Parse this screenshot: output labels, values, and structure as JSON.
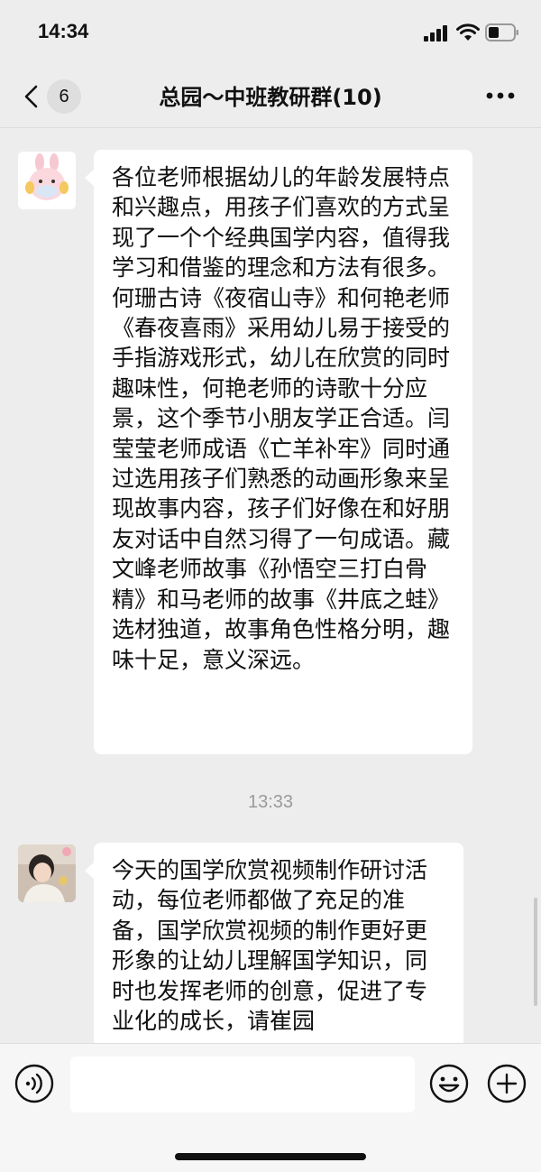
{
  "status_bar": {
    "time": "14:34",
    "icons": [
      "signal-icon",
      "wifi-icon",
      "battery-icon"
    ]
  },
  "nav": {
    "back_icon": "chevron-left-icon",
    "unread_count": "6",
    "title": "总园～中班教研群(10)",
    "more_icon": "more-dots-icon"
  },
  "messages": [
    {
      "avatar_icon": "bunny-avatar",
      "text": "各位老师根据幼儿的年龄发展特点和兴趣点，用孩子们喜欢的方式呈现了一个个经典国学内容，值得我学习和借鉴的理念和方法有很多。何珊古诗《夜宿山寺》和何艳老师《春夜喜雨》采用幼儿易于接受的手指游戏形式，幼儿在欣赏的同时趣味性，何艳老师的诗歌十分应景，这个季节小朋友学正合适。闫莹莹老师成语《亡羊补牢》同时通过选用孩子们熟悉的动画形象来呈现故事内容，孩子们好像在和好朋友对话中自然习得了一句成语。藏文峰老师故事《孙悟空三打白骨精》和马老师的故事《井底之蛙》选材独道，故事角色性格分明，趣味十足，意义深远。"
    },
    {
      "avatar_icon": "photo-avatar",
      "text": "今天的国学欣赏视频制作研讨活动，每位老师都做了充足的准备，国学欣赏视频的制作更好更形象的让幼儿理解国学知识，同时也发挥老师的创意，促进了专业化的成长，请崔园"
    }
  ],
  "timestamp": "13:33",
  "input_bar": {
    "voice_icon": "voice-icon",
    "input_value": "",
    "emoji_icon": "emoji-icon",
    "plus_icon": "plus-icon"
  },
  "colors": {
    "background": "#ededed",
    "bubble": "#ffffff",
    "text": "#111111",
    "timestamp": "#9a9a9a"
  }
}
